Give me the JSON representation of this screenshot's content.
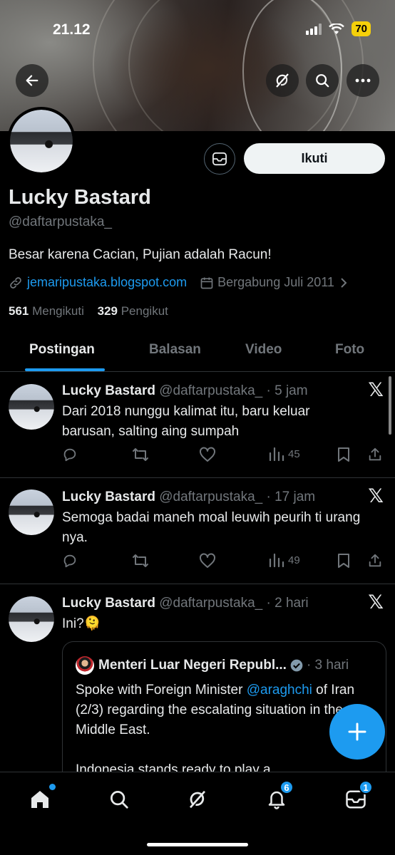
{
  "status_bar": {
    "time": "21.12",
    "battery": "70"
  },
  "profile": {
    "name": "Lucky Bastard",
    "handle": "@daftarpustaka_",
    "bio": "Besar karena Cacian, Pujian adalah Racun!",
    "website": "jemaripustaka.blogspot.com",
    "joined": "Bergabung Juli 2011",
    "following_count": "561",
    "following_label": "Mengikuti",
    "followers_count": "329",
    "followers_label": "Pengikut",
    "follow_label": "Ikuti"
  },
  "tabs": [
    {
      "label": "Postingan",
      "active": true
    },
    {
      "label": "Balasan",
      "active": false
    },
    {
      "label": "Video",
      "active": false
    },
    {
      "label": "Foto",
      "active": false
    }
  ],
  "tweets": [
    {
      "name": "Lucky Bastard",
      "handle_time": "@daftarpustaka_ · 5 jam",
      "text": "Dari 2018 nunggu kalimat itu, baru keluar barusan, salting aing sumpah",
      "views": "45"
    },
    {
      "name": "Lucky Bastard",
      "handle_time": "@daftarpustaka_ · 17 jam",
      "text": "Semoga badai maneh moal leuwih peurih ti urang nya.",
      "views": "49"
    },
    {
      "name": "Lucky Bastard",
      "handle_time": "@daftarpustaka_ · 2 hari",
      "text": "Ini?🫠"
    }
  ],
  "quote": {
    "name": "Menteri Luar Negeri Republ...",
    "time": "· 3 hari",
    "text_before": "Spoke with Foreign Minister ",
    "mention": "@araghchi",
    "text_after": " of Iran (2/3) regarding the escalating situation in the Middle East.",
    "text_more": "Indonesia stands ready to play a"
  },
  "x_logo": "𝕏",
  "nav": {
    "notifications_badge": "6",
    "messages_badge": "1"
  },
  "icons": [
    "back-arrow-icon",
    "grok-icon",
    "search-icon",
    "more-icon",
    "message-icon",
    "link-icon",
    "calendar-icon",
    "chevron-right-icon",
    "reply-icon",
    "retweet-icon",
    "like-icon",
    "views-icon",
    "bookmark-icon",
    "share-icon",
    "compose-plus-icon",
    "home-icon",
    "bell-icon",
    "mail-icon",
    "verified-icon"
  ]
}
